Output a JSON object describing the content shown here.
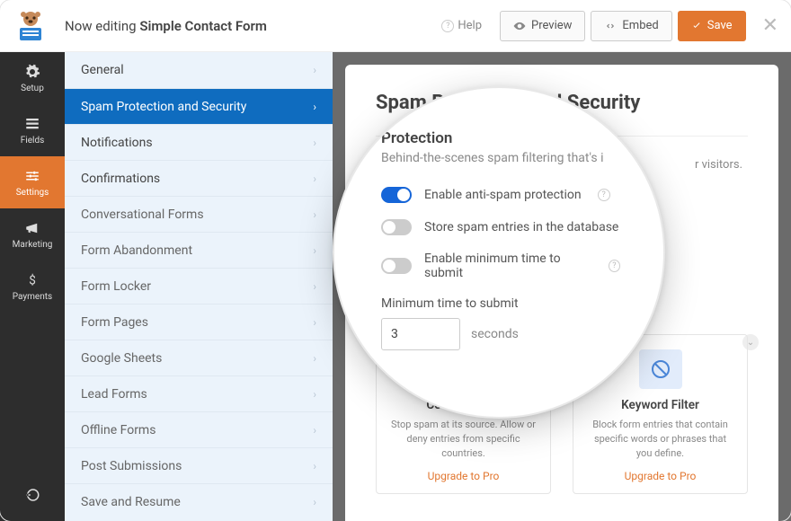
{
  "topbar": {
    "editing_prefix": "Now editing",
    "form_name": "Simple Contact Form",
    "help": "Help",
    "preview": "Preview",
    "embed": "Embed",
    "save": "Save"
  },
  "rail": [
    {
      "id": "setup",
      "label": "Setup"
    },
    {
      "id": "fields",
      "label": "Fields"
    },
    {
      "id": "settings",
      "label": "Settings"
    },
    {
      "id": "marketing",
      "label": "Marketing"
    },
    {
      "id": "payments",
      "label": "Payments"
    }
  ],
  "side": {
    "primary": [
      {
        "id": "general",
        "label": "General"
      },
      {
        "id": "spam",
        "label": "Spam Protection and Security",
        "active": true
      },
      {
        "id": "notifications",
        "label": "Notifications"
      },
      {
        "id": "confirmations",
        "label": "Confirmations"
      }
    ],
    "secondary": [
      "Conversational Forms",
      "Form Abandonment",
      "Form Locker",
      "Form Pages",
      "Google Sheets",
      "Lead Forms",
      "Offline Forms",
      "Post Submissions",
      "Save and Resume"
    ]
  },
  "panel": {
    "title": "Spam Protection and Security",
    "visitors_fragment": "r visitors.",
    "cards": [
      {
        "title": "Country Filter",
        "desc": "Stop spam at its source. Allow or deny entries from specific countries.",
        "cta": "Upgrade to Pro"
      },
      {
        "title": "Keyword Filter",
        "desc": "Block form entries that contain specific words or phrases that you define.",
        "cta": "Upgrade to Pro"
      }
    ]
  },
  "lens": {
    "heading": "Protection",
    "sub": "Behind-the-scenes spam filtering that's i",
    "toggles": [
      {
        "label": "Enable anti-spam protection",
        "on": true,
        "help": true
      },
      {
        "label": "Store spam entries in the database",
        "on": false,
        "help": false
      },
      {
        "label": "Enable minimum time to submit",
        "on": false,
        "help": true
      }
    ],
    "min_label": "Minimum time to submit",
    "min_value": "3",
    "min_unit": "seconds"
  }
}
